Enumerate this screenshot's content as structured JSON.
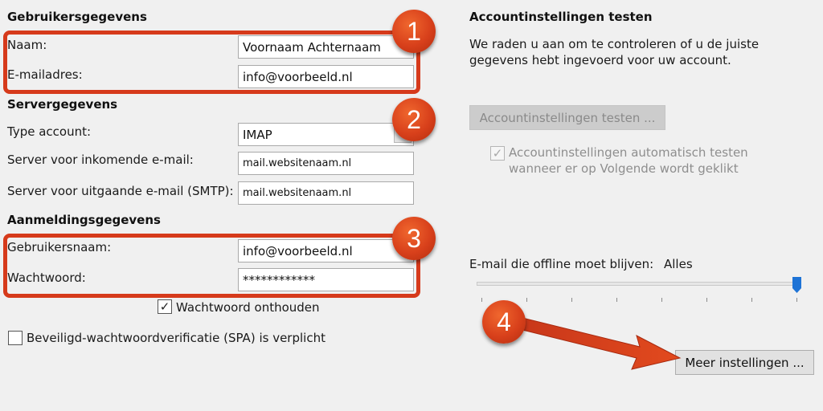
{
  "user_section": {
    "heading": "Gebruikersgegevens",
    "name_label": "Naam:",
    "name_value": "Voornaam Achternaam",
    "email_label": "E-mailadres:",
    "email_value": "info@voorbeeld.nl"
  },
  "server_section": {
    "heading": "Servergegevens",
    "account_type_label": "Type account:",
    "account_type_value": "IMAP",
    "incoming_label": "Server voor inkomende e-mail:",
    "incoming_value": "mail.websitenaam.nl",
    "outgoing_label": "Server voor uitgaande e-mail (SMTP):",
    "outgoing_value": "mail.websitenaam.nl"
  },
  "login_section": {
    "heading": "Aanmeldingsgegevens",
    "username_label": "Gebruikersnaam:",
    "username_value": "info@voorbeeld.nl",
    "password_label": "Wachtwoord:",
    "password_value": "************",
    "remember_label": "Wachtwoord onthouden",
    "remember_checked": true,
    "spa_label": "Beveiligd-wachtwoordverificatie (SPA) is verplicht",
    "spa_checked": false
  },
  "test_section": {
    "heading": "Accountinstellingen testen",
    "description_line1": "We raden u aan om te controleren of u de juiste",
    "description_line2": "gegevens hebt ingevoerd voor uw account.",
    "test_button_label": "Accountinstellingen testen ...",
    "auto_test_line1": "Accountinstellingen automatisch testen",
    "auto_test_line2": "wanneer er op Volgende wordt geklikt",
    "auto_test_checked": true
  },
  "offline": {
    "label": "E-mail die offline moet blijven:",
    "value": "Alles",
    "slider_level": 1.0
  },
  "more_settings_button_label": "Meer instellingen ...",
  "annotations": {
    "badge1": "1",
    "badge2": "2",
    "badge3": "3",
    "badge4": "4"
  },
  "colors": {
    "callout_red": "#d63a1b",
    "slider_thumb": "#1e73d6",
    "background": "#f0f0f0"
  }
}
